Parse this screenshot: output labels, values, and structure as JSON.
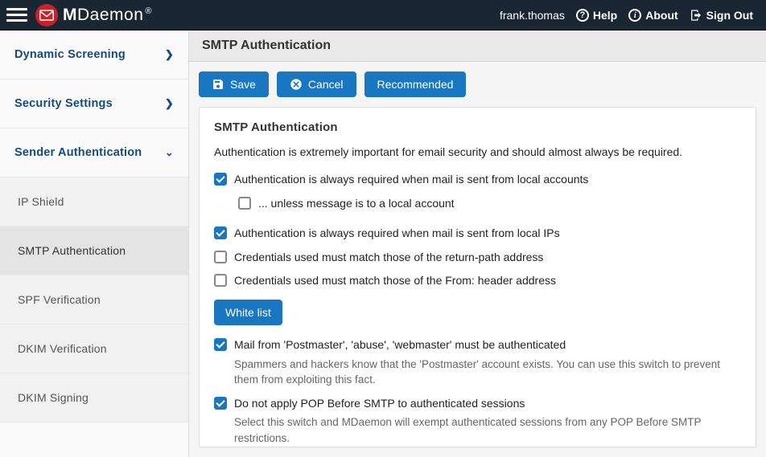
{
  "topbar": {
    "brand_prefix": "M",
    "brand_rest": "Daemon",
    "user": "frank.thomas",
    "help": "Help",
    "about": "About",
    "signout": "Sign Out"
  },
  "sidebar": {
    "dynamic_screening": "Dynamic Screening",
    "security_settings": "Security Settings",
    "sender_authentication": "Sender Authentication",
    "ip_shield": "IP Shield",
    "smtp_auth": "SMTP Authentication",
    "spf": "SPF Verification",
    "dkim_verify": "DKIM Verification",
    "dkim_sign": "DKIM Signing"
  },
  "header": {
    "title": "SMTP Authentication"
  },
  "toolbar": {
    "save": "Save",
    "cancel": "Cancel",
    "recommended": "Recommended"
  },
  "panel": {
    "heading": "SMTP Authentication",
    "intro": "Authentication is extremely important for email security and should almost always be required.",
    "opts": {
      "auth_local_accounts": "Authentication is always required when mail is sent from local accounts",
      "unless_local": "... unless message is to a local account",
      "auth_local_ips": "Authentication is always required when mail is sent from local IPs",
      "match_return_path": "Credentials used must match those of the return-path address",
      "match_from": "Credentials used must match those of the From: header address",
      "whitelist": "White list",
      "postmaster_auth": "Mail from 'Postmaster', 'abuse', 'webmaster' must be authenticated",
      "postmaster_desc": "Spammers and hackers know that the 'Postmaster' account exists. You can use this switch to prevent them from exploiting this fact.",
      "no_pop_before_smtp": "Do not apply POP Before SMTP to authenticated sessions",
      "no_pop_desc": "Select this switch and MDaemon will exempt authenticated sessions from any POP Before SMTP restrictions."
    }
  }
}
